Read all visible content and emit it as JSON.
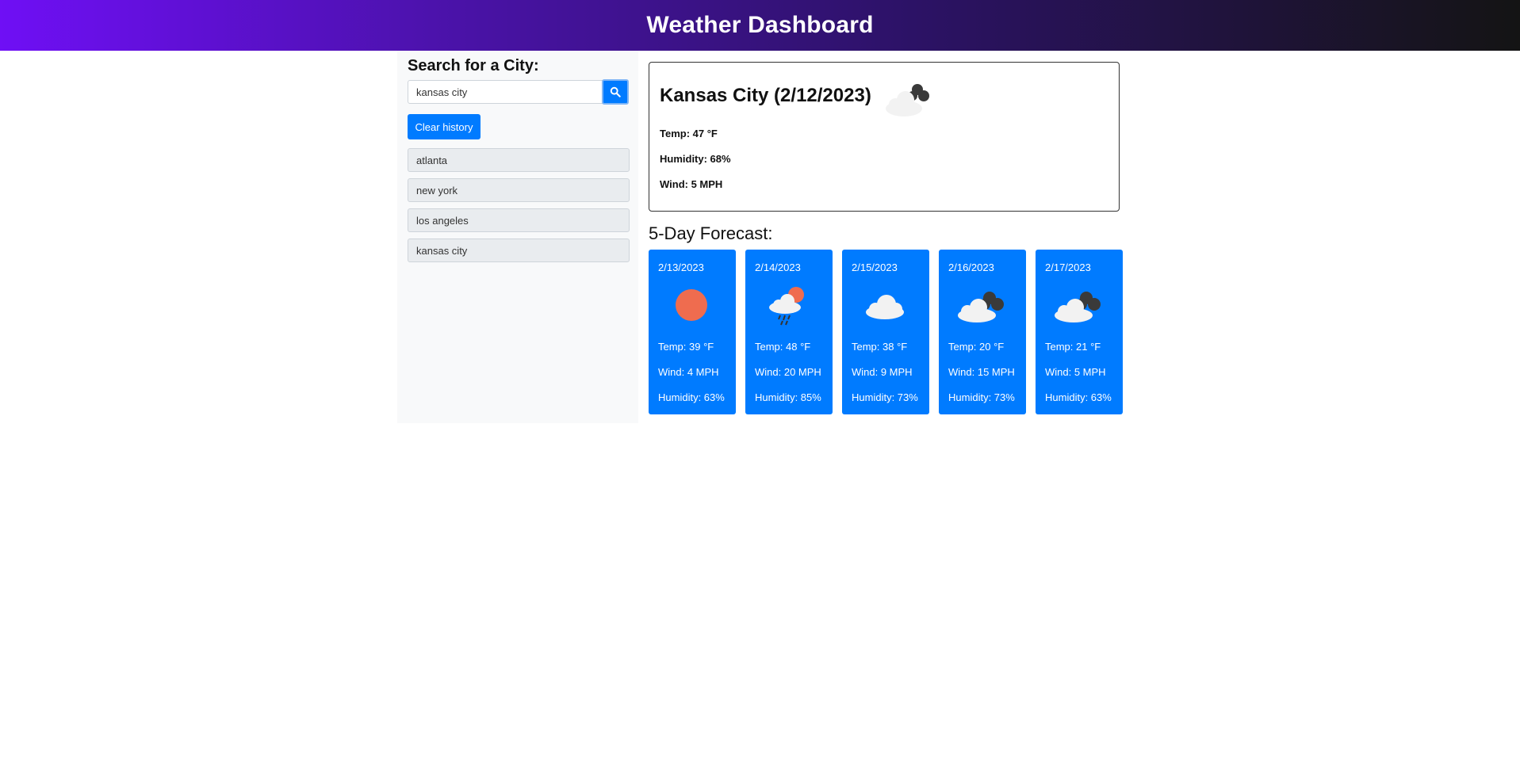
{
  "header": {
    "title": "Weather Dashboard"
  },
  "search": {
    "title": "Search for a City:",
    "value": "kansas city",
    "button_icon": "search-icon",
    "clear_label": "Clear history"
  },
  "history": [
    "atlanta",
    "new york",
    "los angeles",
    "kansas city"
  ],
  "current": {
    "title": "Kansas City (2/12/2023)",
    "icon": "dark-cloud-icon",
    "temp": "Temp: 47 °F",
    "humidity": "Humidity: 68%",
    "wind": "Wind: 5 MPH"
  },
  "forecast": {
    "heading": "5-Day Forecast:",
    "days": [
      {
        "date": "2/13/2023",
        "icon": "sun-icon",
        "temp": "Temp: 39 °F",
        "wind": "Wind: 4 MPH",
        "humidity": "Humidity: 63%"
      },
      {
        "date": "2/14/2023",
        "icon": "rain-sun-icon",
        "temp": "Temp: 48 °F",
        "wind": "Wind: 20 MPH",
        "humidity": "Humidity: 85%"
      },
      {
        "date": "2/15/2023",
        "icon": "cloud-icon",
        "temp": "Temp: 38 °F",
        "wind": "Wind: 9 MPH",
        "humidity": "Humidity: 73%"
      },
      {
        "date": "2/16/2023",
        "icon": "dark-cloud-icon",
        "temp": "Temp: 20 °F",
        "wind": "Wind: 15 MPH",
        "humidity": "Humidity: 73%"
      },
      {
        "date": "2/17/2023",
        "icon": "dark-cloud-icon",
        "temp": "Temp: 21 °F",
        "wind": "Wind: 5 MPH",
        "humidity": "Humidity: 63%"
      }
    ]
  },
  "colors": {
    "accent": "#007bff",
    "sun": "#ef6c4f",
    "cloud_dark": "#3a3a3a",
    "cloud_light": "#f2f2f2"
  }
}
